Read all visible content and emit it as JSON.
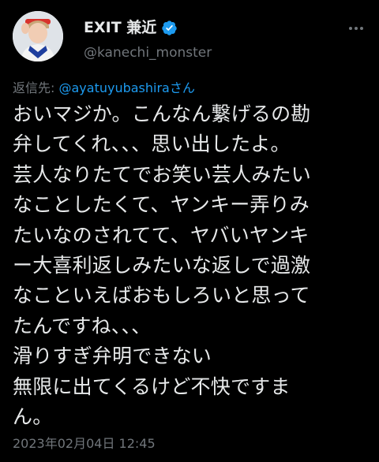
{
  "author": {
    "display_name": "EXIT 兼近",
    "handle": "@kanechi_monster",
    "avatar_icon": "profile-photo",
    "verified_icon": "verified-badge-icon",
    "verified_color": "#1d9bf0"
  },
  "reply": {
    "prefix": "返信先: ",
    "mention": "@ayatuyubashiraさん"
  },
  "tweet": {
    "lines": [
      "おいマジか。こんなん繋げるの勘",
      "弁してくれ、、、思い出したよ。",
      "芸人なりたてでお笑い芸人みたい",
      "なことしたくて、ヤンキー弄りみ",
      "たいなのされてて、ヤバいヤンキ",
      "ー大喜利返しみたいな返しで過激",
      "なこといえばおもしろいと思って",
      "たんですね、、、",
      "滑りすぎ弁明できない",
      "無限に出てくるけど不快ですま",
      "ん。"
    ],
    "timestamp": "2023年02月04日 12:45"
  },
  "menu": {
    "icon": "more-options-icon"
  },
  "colors": {
    "background": "#000000",
    "text_primary": "#e7e9ea",
    "text_secondary": "#71767b",
    "accent": "#1d9bf0"
  }
}
